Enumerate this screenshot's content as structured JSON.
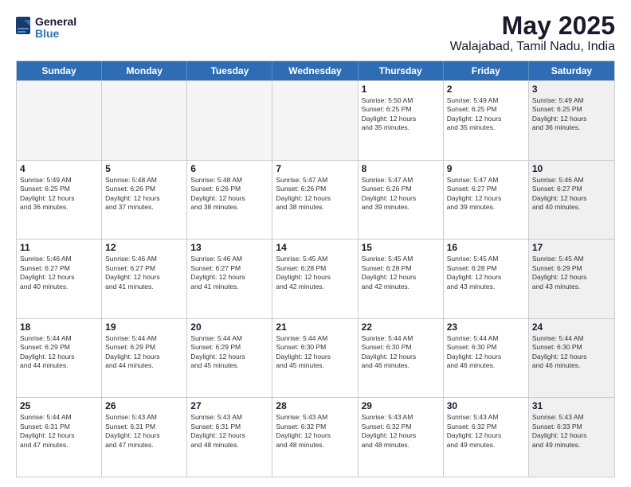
{
  "logo": {
    "general": "General",
    "blue": "Blue"
  },
  "title": "May 2025",
  "subtitle": "Walajabad, Tamil Nadu, India",
  "header_days": [
    "Sunday",
    "Monday",
    "Tuesday",
    "Wednesday",
    "Thursday",
    "Friday",
    "Saturday"
  ],
  "rows": [
    [
      {
        "day": "",
        "empty": true
      },
      {
        "day": "",
        "empty": true
      },
      {
        "day": "",
        "empty": true
      },
      {
        "day": "",
        "empty": true
      },
      {
        "day": "1",
        "info": "Sunrise: 5:50 AM\nSunset: 6:25 PM\nDaylight: 12 hours\nand 35 minutes."
      },
      {
        "day": "2",
        "info": "Sunrise: 5:49 AM\nSunset: 6:25 PM\nDaylight: 12 hours\nand 35 minutes."
      },
      {
        "day": "3",
        "info": "Sunrise: 5:49 AM\nSunset: 6:25 PM\nDaylight: 12 hours\nand 36 minutes.",
        "shaded": true
      }
    ],
    [
      {
        "day": "4",
        "info": "Sunrise: 5:49 AM\nSunset: 6:25 PM\nDaylight: 12 hours\nand 36 minutes."
      },
      {
        "day": "5",
        "info": "Sunrise: 5:48 AM\nSunset: 6:26 PM\nDaylight: 12 hours\nand 37 minutes."
      },
      {
        "day": "6",
        "info": "Sunrise: 5:48 AM\nSunset: 6:26 PM\nDaylight: 12 hours\nand 38 minutes."
      },
      {
        "day": "7",
        "info": "Sunrise: 5:47 AM\nSunset: 6:26 PM\nDaylight: 12 hours\nand 38 minutes."
      },
      {
        "day": "8",
        "info": "Sunrise: 5:47 AM\nSunset: 6:26 PM\nDaylight: 12 hours\nand 39 minutes."
      },
      {
        "day": "9",
        "info": "Sunrise: 5:47 AM\nSunset: 6:27 PM\nDaylight: 12 hours\nand 39 minutes."
      },
      {
        "day": "10",
        "info": "Sunrise: 5:46 AM\nSunset: 6:27 PM\nDaylight: 12 hours\nand 40 minutes.",
        "shaded": true
      }
    ],
    [
      {
        "day": "11",
        "info": "Sunrise: 5:46 AM\nSunset: 6:27 PM\nDaylight: 12 hours\nand 40 minutes."
      },
      {
        "day": "12",
        "info": "Sunrise: 5:46 AM\nSunset: 6:27 PM\nDaylight: 12 hours\nand 41 minutes."
      },
      {
        "day": "13",
        "info": "Sunrise: 5:46 AM\nSunset: 6:27 PM\nDaylight: 12 hours\nand 41 minutes."
      },
      {
        "day": "14",
        "info": "Sunrise: 5:45 AM\nSunset: 6:28 PM\nDaylight: 12 hours\nand 42 minutes."
      },
      {
        "day": "15",
        "info": "Sunrise: 5:45 AM\nSunset: 6:28 PM\nDaylight: 12 hours\nand 42 minutes."
      },
      {
        "day": "16",
        "info": "Sunrise: 5:45 AM\nSunset: 6:28 PM\nDaylight: 12 hours\nand 43 minutes."
      },
      {
        "day": "17",
        "info": "Sunrise: 5:45 AM\nSunset: 6:29 PM\nDaylight: 12 hours\nand 43 minutes.",
        "shaded": true
      }
    ],
    [
      {
        "day": "18",
        "info": "Sunrise: 5:44 AM\nSunset: 6:29 PM\nDaylight: 12 hours\nand 44 minutes."
      },
      {
        "day": "19",
        "info": "Sunrise: 5:44 AM\nSunset: 6:29 PM\nDaylight: 12 hours\nand 44 minutes."
      },
      {
        "day": "20",
        "info": "Sunrise: 5:44 AM\nSunset: 6:29 PM\nDaylight: 12 hours\nand 45 minutes."
      },
      {
        "day": "21",
        "info": "Sunrise: 5:44 AM\nSunset: 6:30 PM\nDaylight: 12 hours\nand 45 minutes."
      },
      {
        "day": "22",
        "info": "Sunrise: 5:44 AM\nSunset: 6:30 PM\nDaylight: 12 hours\nand 46 minutes."
      },
      {
        "day": "23",
        "info": "Sunrise: 5:44 AM\nSunset: 6:30 PM\nDaylight: 12 hours\nand 46 minutes."
      },
      {
        "day": "24",
        "info": "Sunrise: 5:44 AM\nSunset: 6:30 PM\nDaylight: 12 hours\nand 46 minutes.",
        "shaded": true
      }
    ],
    [
      {
        "day": "25",
        "info": "Sunrise: 5:44 AM\nSunset: 6:31 PM\nDaylight: 12 hours\nand 47 minutes."
      },
      {
        "day": "26",
        "info": "Sunrise: 5:43 AM\nSunset: 6:31 PM\nDaylight: 12 hours\nand 47 minutes."
      },
      {
        "day": "27",
        "info": "Sunrise: 5:43 AM\nSunset: 6:31 PM\nDaylight: 12 hours\nand 48 minutes."
      },
      {
        "day": "28",
        "info": "Sunrise: 5:43 AM\nSunset: 6:32 PM\nDaylight: 12 hours\nand 48 minutes."
      },
      {
        "day": "29",
        "info": "Sunrise: 5:43 AM\nSunset: 6:32 PM\nDaylight: 12 hours\nand 48 minutes."
      },
      {
        "day": "30",
        "info": "Sunrise: 5:43 AM\nSunset: 6:32 PM\nDaylight: 12 hours\nand 49 minutes."
      },
      {
        "day": "31",
        "info": "Sunrise: 5:43 AM\nSunset: 6:33 PM\nDaylight: 12 hours\nand 49 minutes.",
        "shaded": true
      }
    ]
  ]
}
